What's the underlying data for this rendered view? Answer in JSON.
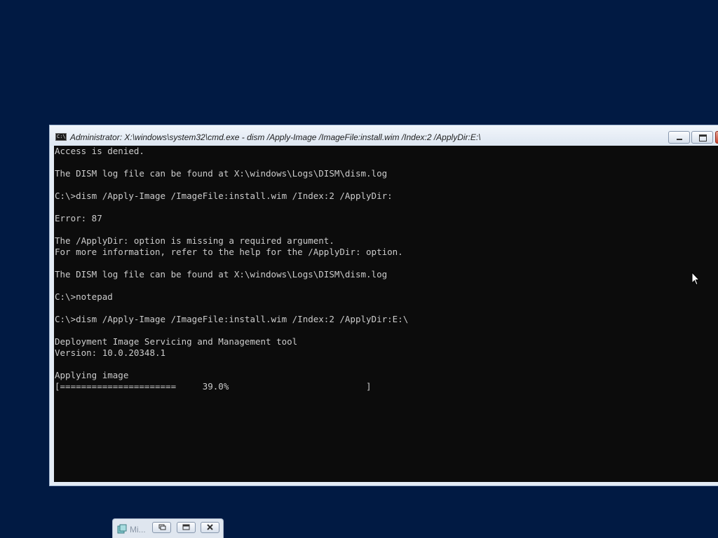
{
  "window": {
    "title": "Administrator: X:\\windows\\system32\\cmd.exe - dism  /Apply-Image /ImageFile:install.wim /Index:2 /ApplyDir:E:\\",
    "icon": "cmd-icon",
    "icon_text": "C:\\"
  },
  "console": {
    "lines": [
      "Access is denied.",
      "",
      "The DISM log file can be found at X:\\windows\\Logs\\DISM\\dism.log",
      "",
      "C:\\>dism /Apply-Image /ImageFile:install.wim /Index:2 /ApplyDir:",
      "",
      "Error: 87",
      "",
      "The /ApplyDir: option is missing a required argument.",
      "For more information, refer to the help for the /ApplyDir: option.",
      "",
      "The DISM log file can be found at X:\\windows\\Logs\\DISM\\dism.log",
      "",
      "C:\\>notepad",
      "",
      "C:\\>dism /Apply-Image /ImageFile:install.wim /Index:2 /ApplyDir:E:\\",
      "",
      "Deployment Image Servicing and Management tool",
      "Version: 10.0.20348.1",
      "",
      "Applying image",
      "[======================     39.0%                          ]"
    ],
    "progress_percent": 39.0
  },
  "taskbar": {
    "minimized_label": "Mi...",
    "icon": "notepad-icon"
  },
  "colors": {
    "desktop": "#011a43",
    "console_bg": "#0c0c0c",
    "console_text": "#cccccc",
    "close_button": "#c7432d"
  }
}
